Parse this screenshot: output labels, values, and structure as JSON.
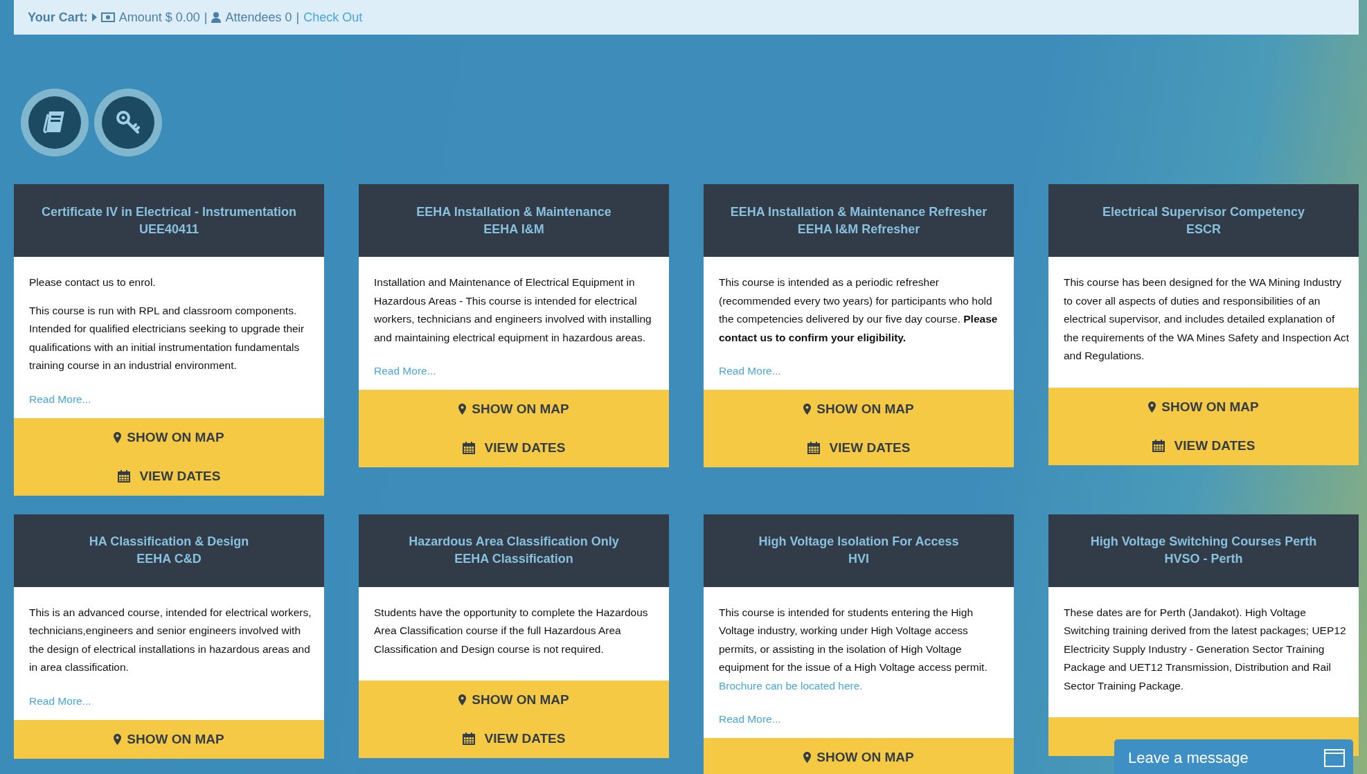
{
  "cart": {
    "label": "Your Cart:",
    "amount": "Amount $ 0.00",
    "separator_1": "|",
    "attendees": "Attendees 0",
    "separator_2": "|",
    "checkout": "Check Out"
  },
  "quick_links": [
    {
      "kind": "book"
    },
    {
      "kind": "key"
    }
  ],
  "courses": [
    {
      "title": "Certificate IV in Electrical - Instrumentation",
      "code": "UEE40411",
      "paragraphs": [
        {
          "text": "Please contact us to enrol."
        },
        {
          "text": "This course is run with RPL and classroom components. Intended for qualified electricians seeking to upgrade their qualifications with an initial instrumentation fundamentals training course in an industrial environment."
        }
      ],
      "read_more": "Read More...",
      "buttons": [
        {
          "kind": "map",
          "label": "SHOW ON MAP"
        },
        {
          "kind": "dates",
          "label": "VIEW DATES"
        }
      ]
    },
    {
      "title": "EEHA Installation & Maintenance",
      "code": "EEHA I&M",
      "paragraphs": [
        {
          "text": "Installation and Maintenance of Electrical Equipment in Hazardous Areas - This course is intended for electrical workers, technicians and engineers involved with installing and maintaining electrical equipment in hazardous areas."
        }
      ],
      "read_more": "Read More...",
      "buttons": [
        {
          "kind": "map",
          "label": "SHOW ON MAP"
        },
        {
          "kind": "dates",
          "label": "VIEW DATES"
        }
      ]
    },
    {
      "title": "EEHA Installation & Maintenance Refresher",
      "code": "EEHA I&M Refresher",
      "paragraphs": [
        {
          "text": "This course is intended as a periodic refresher (recommended every two years) for participants who hold the competencies delivered by our five day course. **Please contact us to confirm your eligibility.**"
        }
      ],
      "read_more": "Read More...",
      "buttons": [
        {
          "kind": "map",
          "label": "SHOW ON MAP"
        },
        {
          "kind": "dates",
          "label": "VIEW DATES"
        }
      ]
    },
    {
      "title": "Electrical Supervisor Competency",
      "code": "ESCR",
      "paragraphs": [
        {
          "text": "This course has been designed for the WA Mining Industry to cover all aspects of duties and responsibilities of an electrical supervisor, and includes detailed explanation of the requirements of the WA Mines Safety and Inspection Act and Regulations."
        }
      ],
      "buttons": [
        {
          "kind": "map",
          "label": "SHOW ON MAP"
        },
        {
          "kind": "dates",
          "label": "VIEW DATES"
        }
      ]
    },
    {
      "title": "HA Classification & Design",
      "code": "EEHA C&D",
      "paragraphs": [
        {
          "text": "This is an advanced course, intended for electrical workers, technicians,engineers and senior engineers involved with the design of electrical installations in hazardous areas and in area classification."
        }
      ],
      "read_more": "Read More...",
      "buttons": [
        {
          "kind": "map",
          "label": "SHOW ON MAP"
        }
      ]
    },
    {
      "title": "Hazardous Area Classification Only",
      "code": "EEHA Classification",
      "paragraphs": [
        {
          "text": "Students have the opportunity to complete the Hazardous Area Classification course if the full Hazardous Area Classification and Design course is not required."
        }
      ],
      "buttons": [
        {
          "kind": "map",
          "label": "SHOW ON MAP"
        },
        {
          "kind": "dates",
          "label": "VIEW DATES"
        }
      ]
    },
    {
      "title": "High Voltage Isolation For Access",
      "code": "HVI",
      "paragraphs": [
        {
          "text": "This course is intended for students entering the High Voltage industry, working under High Voltage access permits, or assisting in the isolation of High Voltage equipment for the issue of a High Voltage access permit.",
          "link": "Brochure can be located here."
        }
      ],
      "read_more": "Read More...",
      "buttons": [
        {
          "kind": "map",
          "label": "SHOW ON MAP"
        }
      ]
    },
    {
      "title": "High Voltage Switching Courses Perth",
      "code": "HVSO - Perth",
      "paragraphs": [
        {
          "text": "These dates are for Perth (Jandakot).  High Voltage Switching training derived from the latest packages; UEP12 Electricity Supply Industry - Generation Sector Training Package and UET12 Transmission, Distribution and Rail Sector Training Package."
        }
      ]
    }
  ],
  "chat": {
    "label": "Leave a message"
  }
}
